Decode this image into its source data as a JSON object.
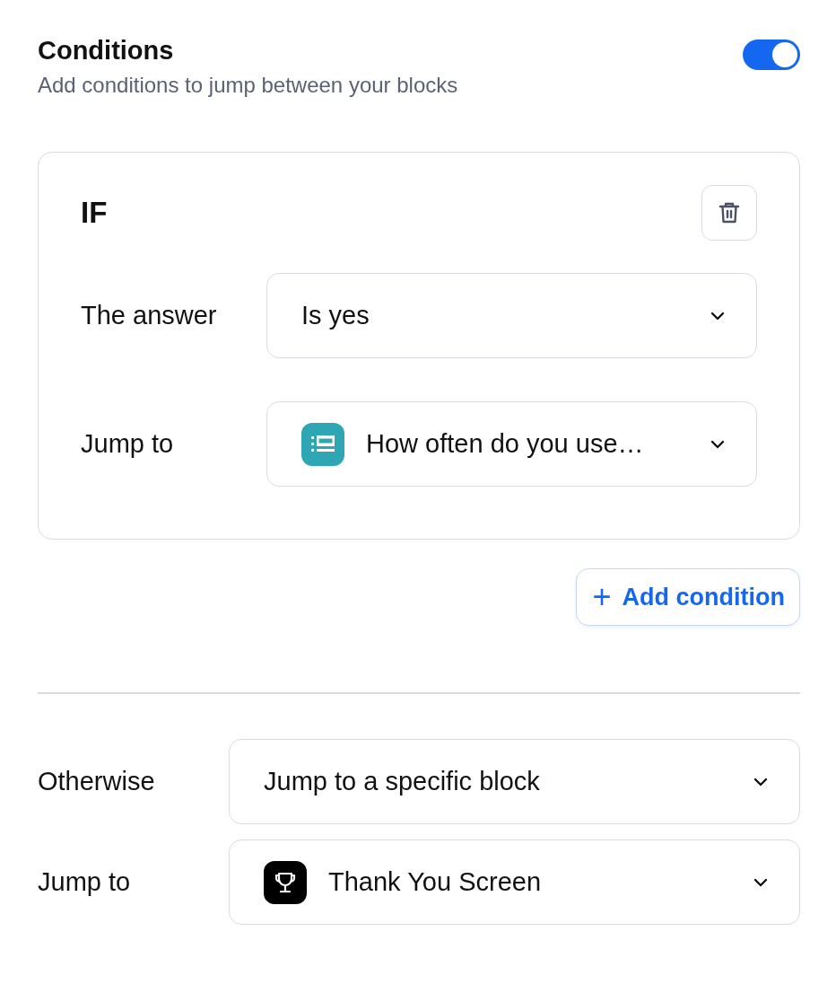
{
  "header": {
    "title": "Conditions",
    "subtitle": "Add conditions to jump between your blocks",
    "enabled": true
  },
  "condition": {
    "heading": "IF",
    "rows": [
      {
        "label": "The answer",
        "value": "Is yes",
        "kind": "plain"
      },
      {
        "label": "Jump to",
        "value": "How often do you use…",
        "kind": "list"
      }
    ]
  },
  "add_button": {
    "label": "Add condition",
    "icon": "+"
  },
  "fallback": [
    {
      "label": "Otherwise",
      "value": "Jump to a specific block",
      "kind": "plain"
    },
    {
      "label": "Jump to",
      "value": "Thank You Screen",
      "kind": "trophy"
    }
  ]
}
